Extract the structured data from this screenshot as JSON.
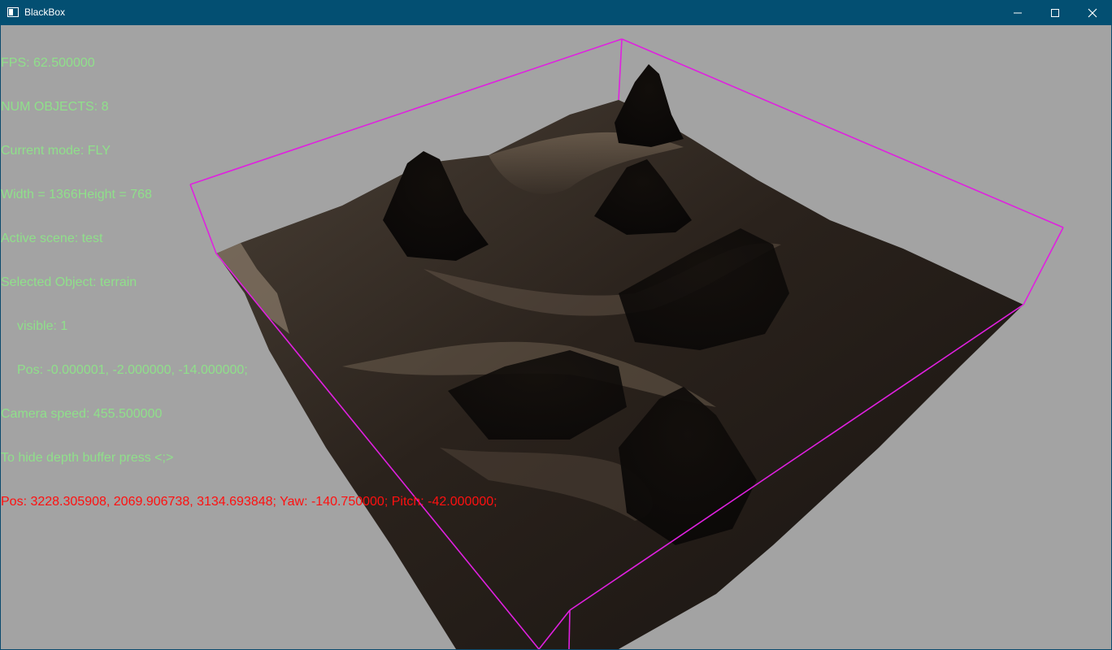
{
  "window": {
    "title": "BlackBox"
  },
  "hud": {
    "fps": "FPS: 62.500000",
    "num_objects": "NUM OBJECTS: 8",
    "mode": "Current mode: FLY",
    "size": "Width = 1366Height = 768",
    "scene": "Active scene: test",
    "selected": "Selected Object: terrain",
    "visible": "visible: 1",
    "obj_pos": "Pos: -0.000001, -2.000000, -14.000000;",
    "camera_speed": "Camera speed: 455.500000",
    "hint": "To hide depth buffer press <;>",
    "camera": "Pos: 3228.305908, 2069.906738, 3134.693848; Yaw: -140.750000; Pitch: -42.000000;"
  },
  "colors": {
    "hud_text": "#8fe08a",
    "hud_camera": "#ff1010",
    "bbox": "#e020e0",
    "viewport_bg": "#a3a3a3",
    "titlebar": "#034f72"
  },
  "icons": [
    "app-icon",
    "minimize-icon",
    "maximize-icon",
    "close-icon"
  ]
}
